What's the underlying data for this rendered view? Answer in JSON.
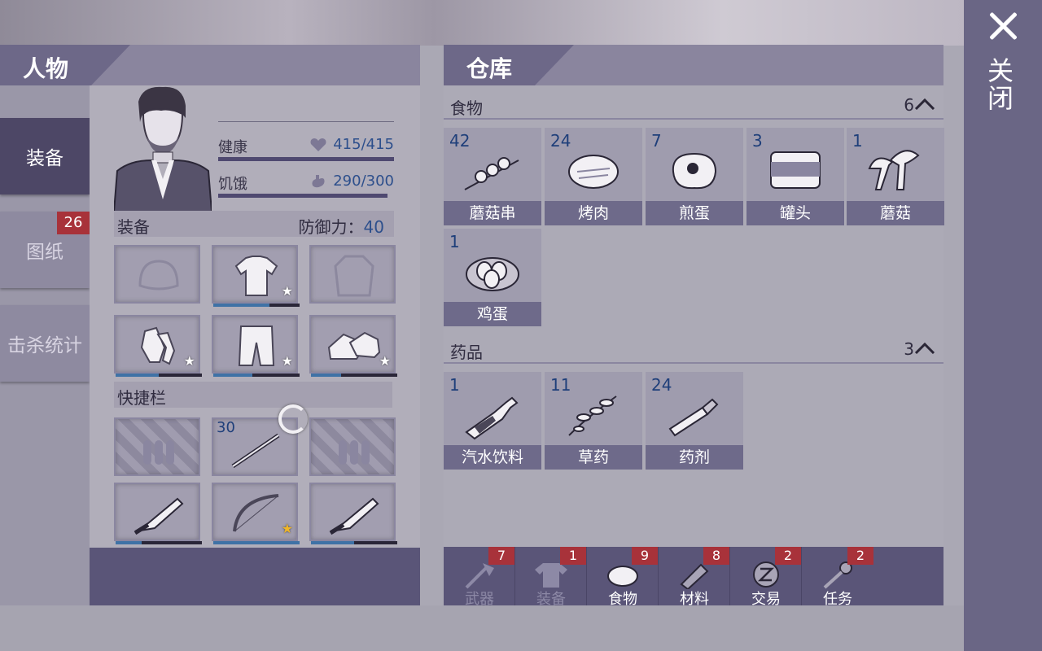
{
  "close": {
    "label": "关闭"
  },
  "character": {
    "title": "人物",
    "stats": {
      "health_label": "健康",
      "health_value": "415/415",
      "hunger_label": "饥饿",
      "hunger_value": "290/300"
    },
    "equipment_label": "装备",
    "defense_label": "防御力：",
    "defense_value": "40",
    "hotbar_label": "快捷栏",
    "slots": [
      {
        "name": "hat",
        "durability": null,
        "star": false
      },
      {
        "name": "shirt",
        "durability": 0.65,
        "star": true
      },
      {
        "name": "jacket",
        "durability": null,
        "star": false
      },
      {
        "name": "gloves",
        "durability": 0.5,
        "star": true
      },
      {
        "name": "pants",
        "durability": 0.45,
        "star": true
      },
      {
        "name": "boots",
        "durability": 0.35,
        "star": true
      }
    ],
    "hotbar": [
      {
        "name": "empty-ammo"
      },
      {
        "name": "spear",
        "count": "30"
      },
      {
        "name": "empty-ammo"
      },
      {
        "name": "machete",
        "durability": 0.3
      },
      {
        "name": "bow",
        "durability": 1.0,
        "gold_star": true
      },
      {
        "name": "machete",
        "durability": 0.5
      }
    ]
  },
  "tabs": [
    {
      "label": "装备",
      "active": true
    },
    {
      "label": "图纸",
      "badge": "26"
    },
    {
      "label": "击杀统计"
    }
  ],
  "warehouse": {
    "title": "仓库",
    "food": {
      "label": "食物",
      "count": "6",
      "items": [
        {
          "count": "42",
          "name": "蘑菇串"
        },
        {
          "count": "24",
          "name": "烤肉"
        },
        {
          "count": "7",
          "name": "煎蛋"
        },
        {
          "count": "3",
          "name": "罐头"
        },
        {
          "count": "1",
          "name": "蘑菇"
        },
        {
          "count": "1",
          "name": "鸡蛋"
        }
      ]
    },
    "medicine": {
      "label": "药品",
      "count": "3",
      "items": [
        {
          "count": "1",
          "name": "汽水饮料"
        },
        {
          "count": "11",
          "name": "草药"
        },
        {
          "count": "24",
          "name": "药剂"
        }
      ]
    },
    "bottom_tabs": [
      {
        "label": "武器",
        "badge": "7",
        "dim": true
      },
      {
        "label": "装备",
        "badge": "1",
        "dim": true
      },
      {
        "label": "食物",
        "badge": "9"
      },
      {
        "label": "材料",
        "badge": "8"
      },
      {
        "label": "交易",
        "badge": "2"
      },
      {
        "label": "任务",
        "badge": "2"
      }
    ]
  }
}
